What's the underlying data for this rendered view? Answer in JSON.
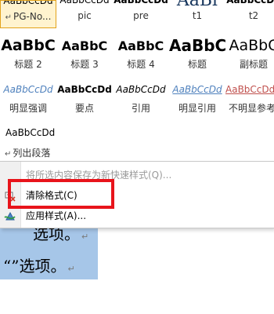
{
  "styles_gallery": {
    "row1": [
      {
        "sample": "AaBbCcDd",
        "label": "PG-No...",
        "selected": true
      },
      {
        "sample": "AaBbCcDd",
        "label": "pic"
      },
      {
        "sample": "AaBbCcDd",
        "label": "pre"
      },
      {
        "sample": "AaBl",
        "label": "t1"
      },
      {
        "sample": "AaBbCcDd",
        "label": "t2"
      }
    ],
    "row2": [
      {
        "sample": "AaBbC",
        "label": "标题 2"
      },
      {
        "sample": "AaBbC",
        "label": "标题 3"
      },
      {
        "sample": "AaBbC",
        "label": "标题 4"
      },
      {
        "sample": "AaBbC",
        "label": "标题"
      },
      {
        "sample": "AaBbC",
        "label": "副标题"
      }
    ],
    "row3": [
      {
        "sample": "AaBbCcDd",
        "label": "明显强调"
      },
      {
        "sample": "AaBbCcDd",
        "label": "要点"
      },
      {
        "sample": "AaBbCcDd",
        "label": "引用"
      },
      {
        "sample": "AaBbCcDd",
        "label": "明显引用"
      },
      {
        "sample": "AaBbCcDd",
        "label": "不明显参考"
      }
    ],
    "row4": {
      "sample": "AaBbCcDd",
      "label": "列出段落"
    },
    "paragraph_mark": "↵"
  },
  "context_menu": {
    "items": [
      {
        "label": "将所选内容保存为新快速样式(Q)...",
        "icon": "save-style-icon",
        "disabled": true
      },
      {
        "label": "清除格式(C)",
        "icon": "clear-format-icon",
        "disabled": false
      },
      {
        "label": "应用样式(A)...",
        "icon": "apply-styles-icon",
        "disabled": false
      }
    ]
  },
  "document": {
    "line1": "选项。",
    "line2": "“”选项。",
    "paragraph_mark": "↵"
  },
  "colors": {
    "highlight": "#e8141b",
    "selection": "#a6c6e8",
    "accent_blue": "#4f81bd"
  }
}
